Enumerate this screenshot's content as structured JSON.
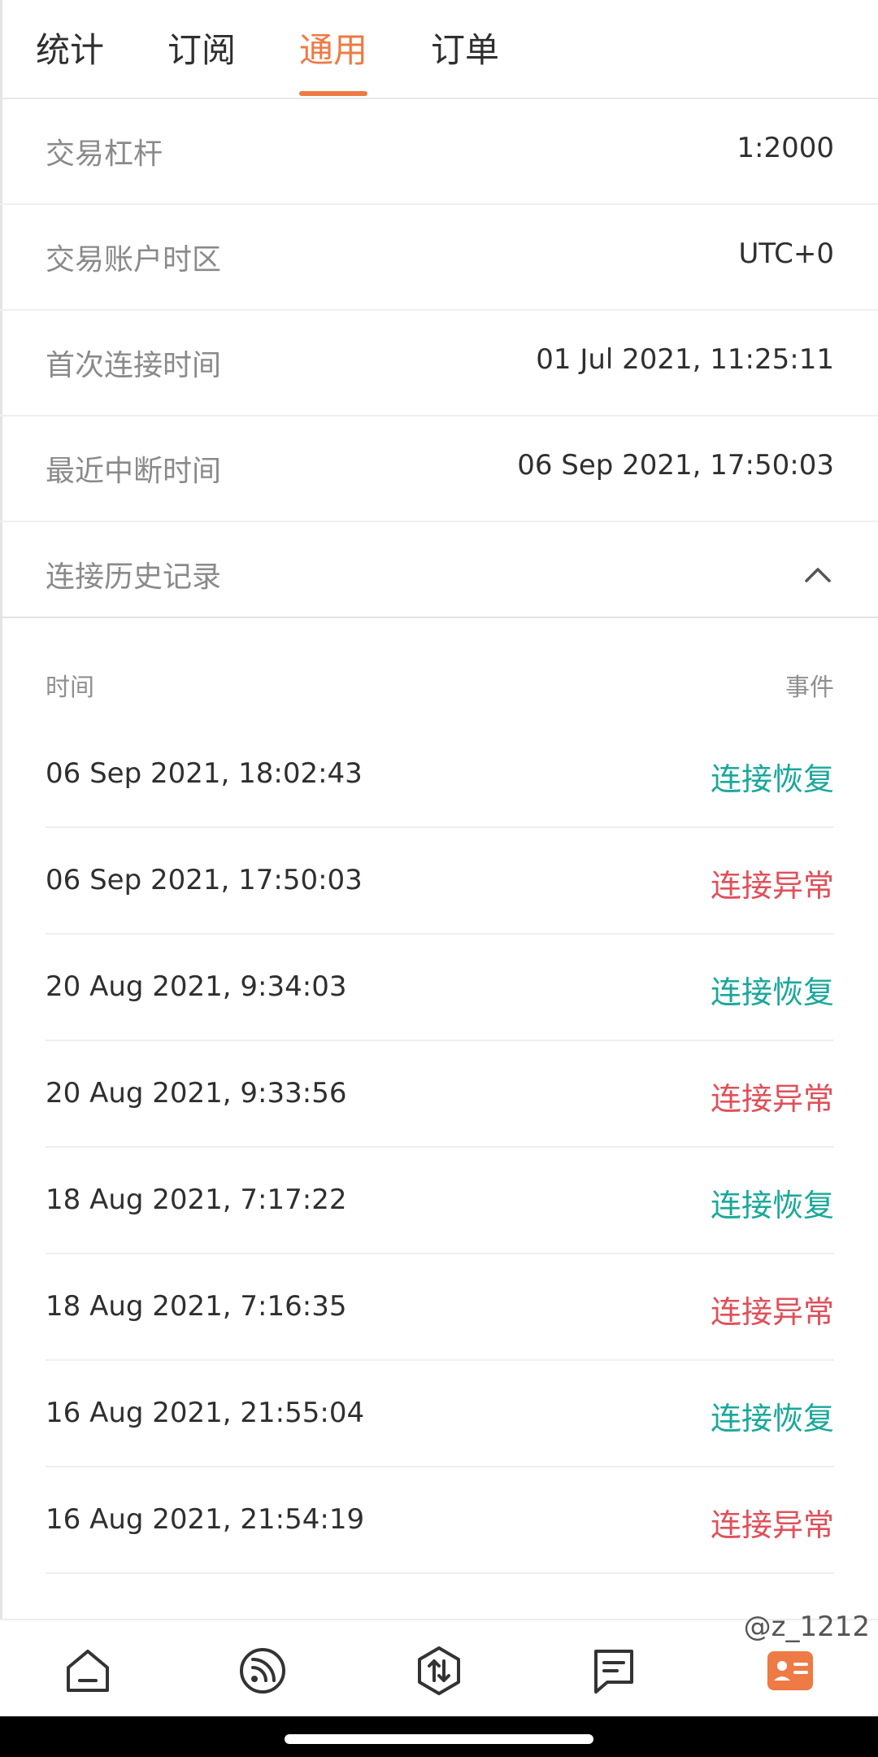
{
  "tabs": [
    {
      "label": "统计"
    },
    {
      "label": "订阅"
    },
    {
      "label": "通用"
    },
    {
      "label": "订单"
    }
  ],
  "info": {
    "leverage_label": "交易杠杆",
    "leverage_value": "1:2000",
    "timezone_label": "交易账户时区",
    "timezone_value": "UTC+0",
    "first_connect_label": "首次连接时间",
    "first_connect_value": "01 Jul 2021, 11:25:11",
    "last_disconnect_label": "最近中断时间",
    "last_disconnect_value": "06 Sep 2021, 17:50:03",
    "history_label": "连接历史记录"
  },
  "history": {
    "time_header": "时间",
    "event_header": "事件",
    "rows": [
      {
        "time": "06 Sep 2021, 18:02:43",
        "event": "连接恢复"
      },
      {
        "time": "06 Sep 2021, 17:50:03",
        "event": "连接异常"
      },
      {
        "time": "20 Aug 2021, 9:34:03",
        "event": "连接恢复"
      },
      {
        "time": "20 Aug 2021, 9:33:56",
        "event": "连接异常"
      },
      {
        "time": "18 Aug 2021, 7:17:22",
        "event": "连接恢复"
      },
      {
        "time": "18 Aug 2021, 7:16:35",
        "event": "连接异常"
      },
      {
        "time": "16 Aug 2021, 21:55:04",
        "event": "连接恢复"
      },
      {
        "time": "16 Aug 2021, 21:54:19",
        "event": "连接异常"
      }
    ]
  },
  "nav": {
    "items": [
      "home-icon",
      "feed-icon",
      "trade-icon",
      "message-icon",
      "profile-card-icon"
    ]
  },
  "watermark": "@z_1212",
  "colors": {
    "accent": "#ee7a45",
    "recovered": "#1aa89a",
    "error": "#e0505a"
  }
}
